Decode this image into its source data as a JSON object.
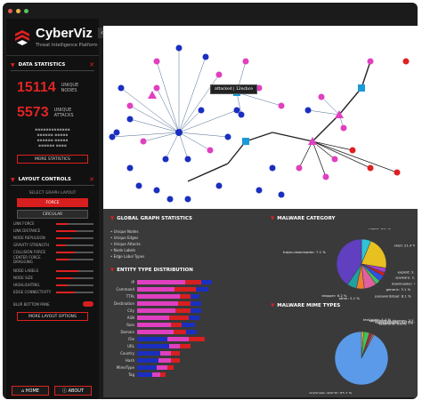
{
  "app": {
    "name": "CyberViz",
    "subtitle": "Threat Intelligence Platform"
  },
  "sidebar": {
    "stats_header": "DATA STATISTICS",
    "nodes_value": "15114",
    "nodes_label_1": "UNIQUE",
    "nodes_label_2": "NODES",
    "attacks_value": "5573",
    "attacks_label_1": "UNIQUE",
    "attacks_label_2": "ATTACKS",
    "more_stats_label": "MORE STATISTICS",
    "layout_header": "LAYOUT CONTROLS",
    "layout_select_label": "SELECT GRAPH LAYOUT",
    "layout_option_1": "FORCE",
    "layout_option_2": "CIRCULAR",
    "option_labels": [
      "LINK FORCE",
      "LINK DISTANCE",
      "NODE REPULSION",
      "GRAVITY STRENGTH",
      "COLLISION FORCE",
      "CENTER FORCE DRAGGING",
      "NODE LABELS",
      "NODE SIZE",
      "HIGHLIGHTING",
      "EDGE CONNECTIVITY"
    ],
    "option_levels": [
      0.3,
      0.55,
      0.4,
      0.25,
      0.5,
      0.35,
      0.6,
      0.45,
      0.3,
      0.5
    ],
    "toggle_label": "BLUR BOTTOM PANE",
    "more_layout_label": "MORE LAYOUT OPTIONS",
    "home_label": "HOME",
    "about_label": "ABOUT"
  },
  "graph": {
    "tooltip": "attacked | 12ecbce",
    "unique_labels": [
      "Unique Nodes",
      "Unique Attacks"
    ]
  },
  "bottom": {
    "global_header": "GLOBAL GRAPH STATISTICS",
    "global_items": [
      "Unique Nodes",
      "Unique Edges",
      "Unique Attacks",
      "Node Labels",
      "Edge Label Types"
    ],
    "malware_header": "MALWARE CATEGORY",
    "malware_labels": [
      "trojan",
      "shell",
      "exploit",
      "spyware",
      "downloader",
      "generic",
      "passwordsteal",
      "other",
      "dropper",
      "trojan-downloader"
    ],
    "malware_pcts": [
      "6.2 %",
      "21.4 %",
      "3.1 %",
      "2.2 %",
      "4.1 %",
      "3.1 %",
      "8.1 %",
      "5.1 %",
      "6.2 %",
      "7.1 %"
    ],
    "entity_header": "ENTITY TYPE DISTRIBUTION",
    "entity_labels": [
      "IP",
      "Command",
      "TTPs",
      "Destination",
      "City",
      "ASN",
      "Rule",
      "Domain",
      "File",
      "URL",
      "Country",
      "Hash",
      "MimeType",
      "Tag"
    ],
    "mime_header": "MALWARE MIME TYPES",
    "mime_labels": [
      "text/plain",
      "application/x-dosexec",
      "application/zip",
      "text/x-shellscript",
      "text/html",
      "text/plain (ASCII)"
    ],
    "mime_pcts": [
      "1.4 %",
      "3.5 %",
      "1.3 %",
      "0.8 %",
      "0.8 %",
      "85.2 %"
    ]
  }
}
